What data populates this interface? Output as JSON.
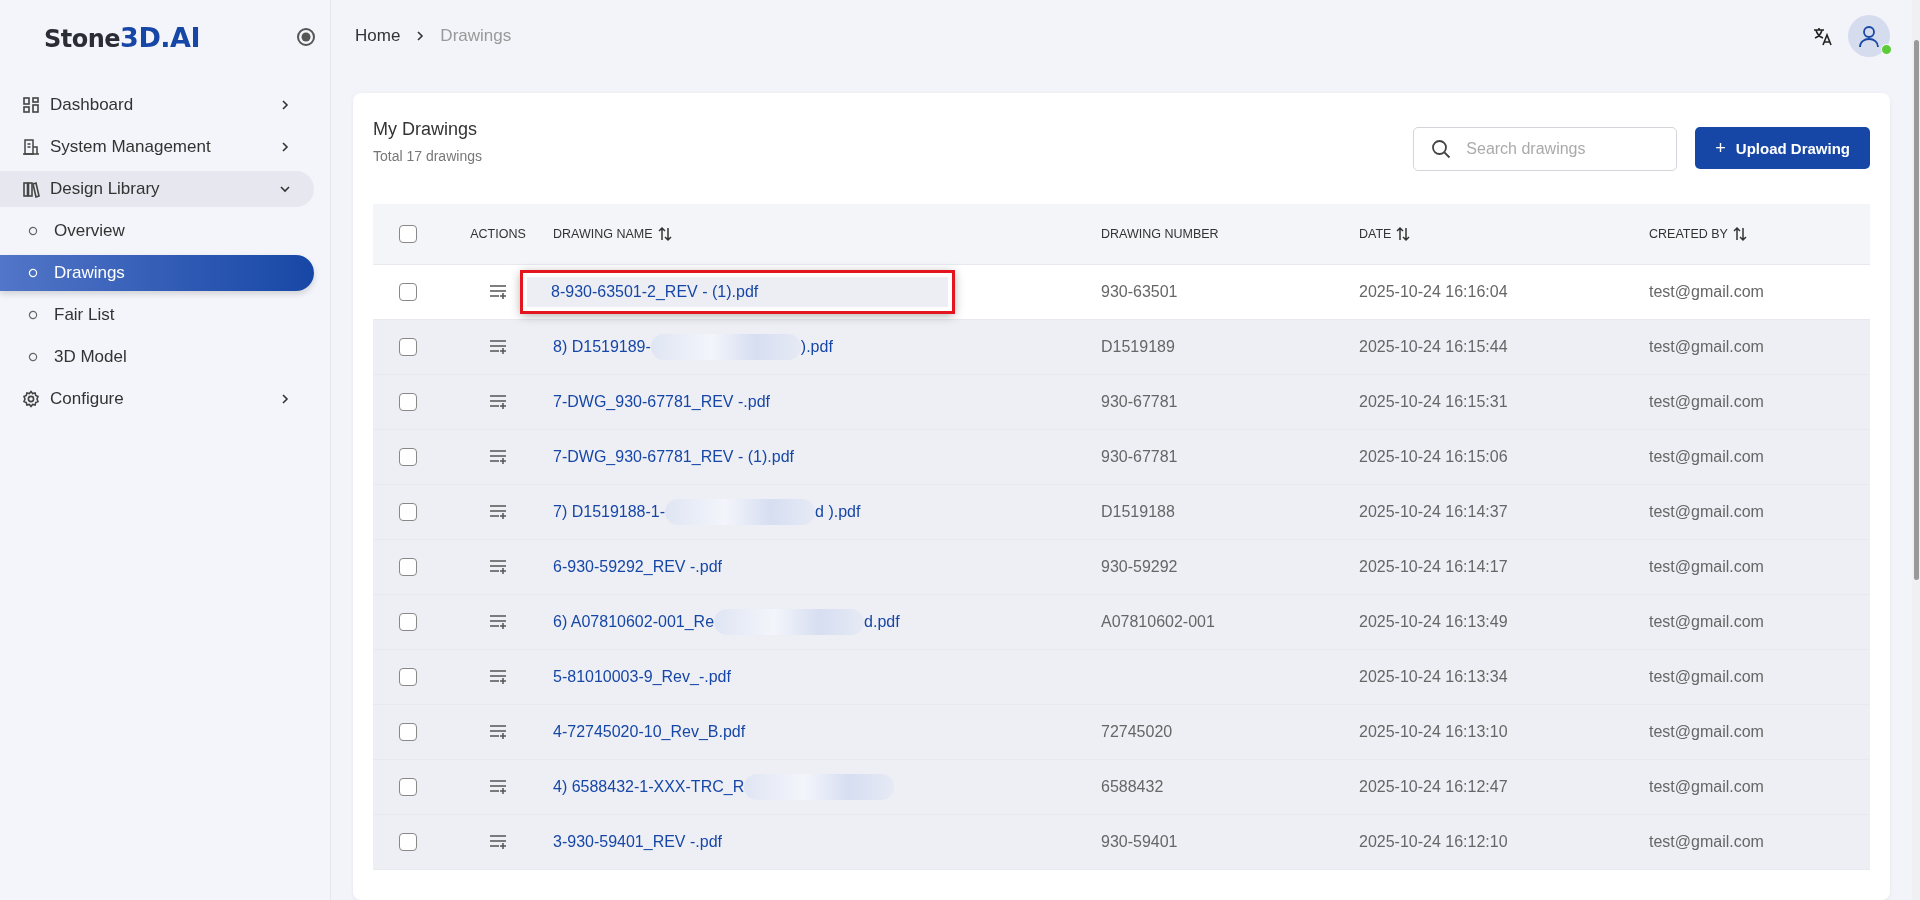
{
  "logo": {
    "text": "Stone",
    "accent": "3D.AI"
  },
  "sidebar": {
    "items": [
      {
        "label": "Dashboard",
        "expanded": false,
        "selected": false
      },
      {
        "label": "System Management",
        "expanded": false,
        "selected": false
      },
      {
        "label": "Design Library",
        "expanded": true,
        "selected": false,
        "children": [
          {
            "label": "Overview",
            "selected": false
          },
          {
            "label": "Drawings",
            "selected": true
          },
          {
            "label": "Fair List",
            "selected": false
          },
          {
            "label": "3D Model",
            "selected": false
          }
        ]
      },
      {
        "label": "Configure",
        "expanded": false,
        "selected": false
      }
    ]
  },
  "breadcrumb": [
    "Home",
    "Drawings"
  ],
  "card": {
    "title": "My Drawings",
    "subtitle": "Total 17 drawings",
    "search": {
      "placeholder": "Search drawings"
    },
    "upload_button": {
      "icon": "+",
      "label": "Upload Drawing"
    }
  },
  "table": {
    "columns": [
      {
        "label": "ACTIONS",
        "sortable": false
      },
      {
        "label": "DRAWING NAME",
        "sortable": true
      },
      {
        "label": "DRAWING NUMBER",
        "sortable": false
      },
      {
        "label": "DATE",
        "sortable": true
      },
      {
        "label": "CREATED BY",
        "sortable": true
      }
    ],
    "header_checked": false,
    "rows": [
      {
        "name": "8-930-63501-2_REV - (1).pdf",
        "redacted": false,
        "name_end": "",
        "number": "930-63501",
        "date": "2025-10-24 16:16:04",
        "created_by": "test@gmail.com",
        "checked": false,
        "highlighted": true
      },
      {
        "name": "8) D1519189-",
        "redacted": true,
        "name_end": ").pdf",
        "number": "D1519189",
        "date": "2025-10-24 16:15:44",
        "created_by": "test@gmail.com",
        "checked": false,
        "highlighted": false
      },
      {
        "name": "7-DWG_930-67781_REV -.pdf",
        "redacted": false,
        "name_end": "",
        "number": "930-67781",
        "date": "2025-10-24 16:15:31",
        "created_by": "test@gmail.com",
        "checked": false,
        "highlighted": false
      },
      {
        "name": "7-DWG_930-67781_REV - (1).pdf",
        "redacted": false,
        "name_end": "",
        "number": "930-67781",
        "date": "2025-10-24 16:15:06",
        "created_by": "test@gmail.com",
        "checked": false,
        "highlighted": false
      },
      {
        "name": "7) D1519188-1-",
        "redacted": true,
        "name_end": "d ).pdf",
        "number": "D1519188",
        "date": "2025-10-24 16:14:37",
        "created_by": "test@gmail.com",
        "checked": false,
        "highlighted": false
      },
      {
        "name": "6-930-59292_REV -.pdf",
        "redacted": false,
        "name_end": "",
        "number": "930-59292",
        "date": "2025-10-24 16:14:17",
        "created_by": "test@gmail.com",
        "checked": false,
        "highlighted": false
      },
      {
        "name": "6) A07810602-001_Re",
        "redacted": true,
        "name_end": "d.pdf",
        "number": "A07810602-001",
        "date": "2025-10-24 16:13:49",
        "created_by": "test@gmail.com",
        "checked": false,
        "highlighted": false
      },
      {
        "name": "5-81010003-9_Rev_-.pdf",
        "redacted": false,
        "name_end": "",
        "number": "",
        "date": "2025-10-24 16:13:34",
        "created_by": "test@gmail.com",
        "checked": false,
        "highlighted": false
      },
      {
        "name": "4-72745020-10_Rev_B.pdf",
        "redacted": false,
        "name_end": "",
        "number": "72745020",
        "date": "2025-10-24 16:13:10",
        "created_by": "test@gmail.com",
        "checked": false,
        "highlighted": false
      },
      {
        "name": "4) 6588432-1-XXX-TRC_R",
        "redacted": true,
        "name_end": "",
        "number": "6588432",
        "date": "2025-10-24 16:12:47",
        "created_by": "test@gmail.com",
        "checked": false,
        "highlighted": false
      },
      {
        "name": "3-930-59401_REV -.pdf",
        "redacted": false,
        "name_end": "",
        "number": "930-59401",
        "date": "2025-10-24 16:12:10",
        "created_by": "test@gmail.com",
        "checked": false,
        "highlighted": false
      }
    ]
  }
}
